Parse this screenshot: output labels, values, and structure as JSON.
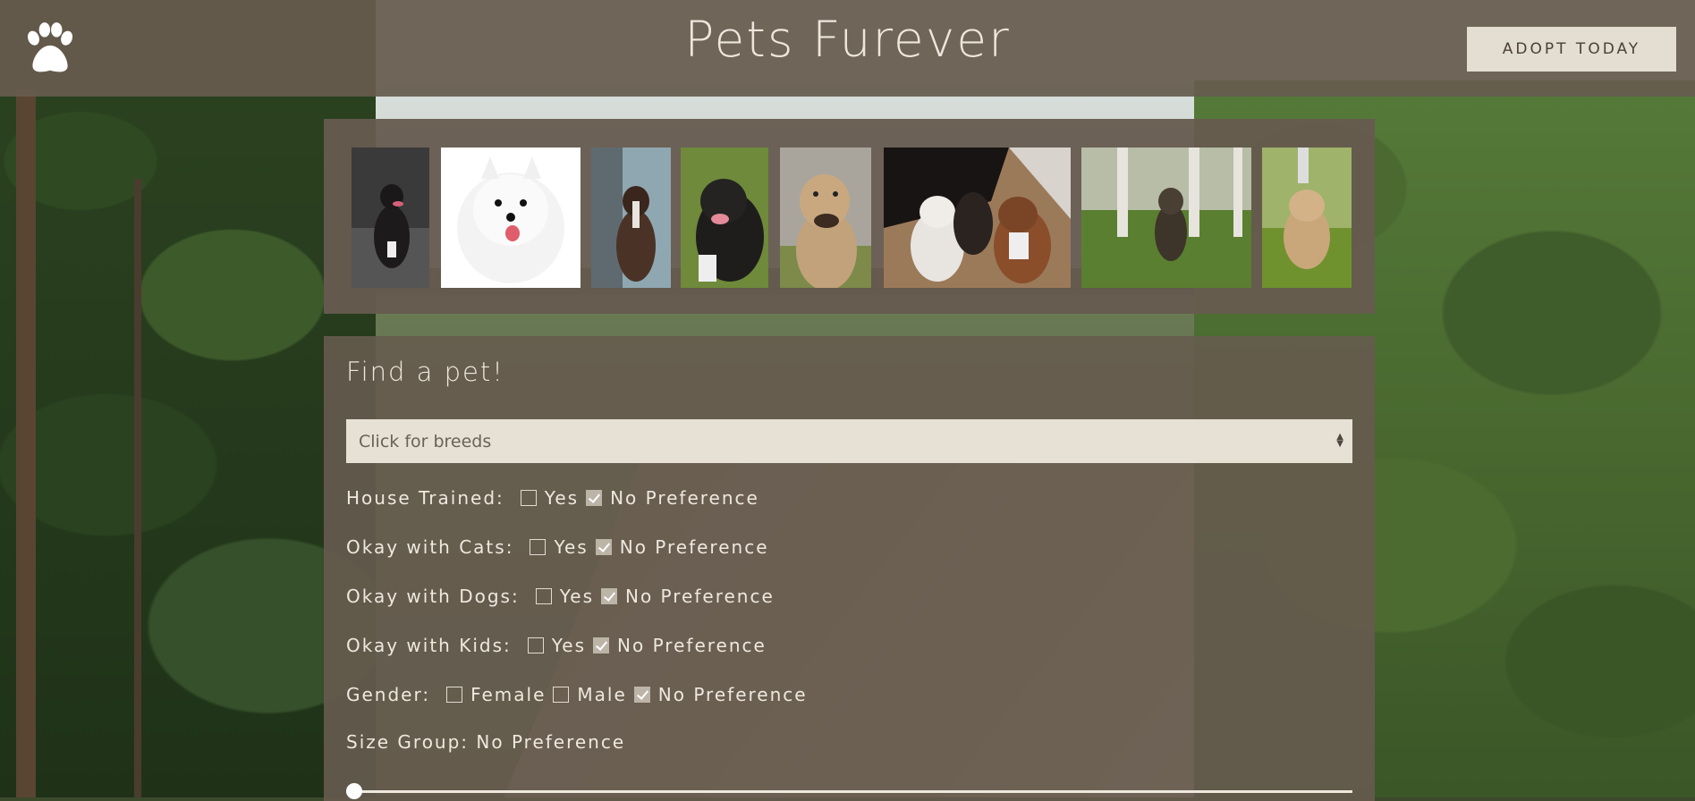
{
  "header": {
    "title": "Pets Furever",
    "adopt_button": "ADOPT TODAY",
    "logo_icon": "paw-icon"
  },
  "gallery": {
    "photos": [
      {
        "alt": "dog photo 1"
      },
      {
        "alt": "dog photo 2"
      },
      {
        "alt": "dog photo 3"
      },
      {
        "alt": "dog photo 4"
      },
      {
        "alt": "dog photo 5"
      },
      {
        "alt": "dog photo 6"
      },
      {
        "alt": "dog photo 7"
      },
      {
        "alt": "dog photo 8"
      }
    ]
  },
  "search": {
    "title": "Find a pet!",
    "breed_placeholder": "Click for breeds",
    "filters": [
      {
        "label": "House Trained:",
        "options": [
          {
            "text": "Yes",
            "checked": false
          },
          {
            "text": "No Preference",
            "checked": true
          }
        ]
      },
      {
        "label": "Okay with Cats:",
        "options": [
          {
            "text": "Yes",
            "checked": false
          },
          {
            "text": "No Preference",
            "checked": true
          }
        ]
      },
      {
        "label": "Okay with Dogs:",
        "options": [
          {
            "text": "Yes",
            "checked": false
          },
          {
            "text": "No Preference",
            "checked": true
          }
        ]
      },
      {
        "label": "Okay with Kids:",
        "options": [
          {
            "text": "Yes",
            "checked": false
          },
          {
            "text": "No Preference",
            "checked": true
          }
        ]
      },
      {
        "label": "Gender:",
        "options": [
          {
            "text": "Female",
            "checked": false
          },
          {
            "text": "Male",
            "checked": false
          },
          {
            "text": "No Preference",
            "checked": true
          }
        ]
      }
    ],
    "size_label": "Size Group: No Preference",
    "size_slider_value": 0
  },
  "colors": {
    "header_bg": "#665b4f",
    "button_bg": "#e3ddd2",
    "panel_bg": "#665b4f",
    "text": "#efe8de"
  }
}
